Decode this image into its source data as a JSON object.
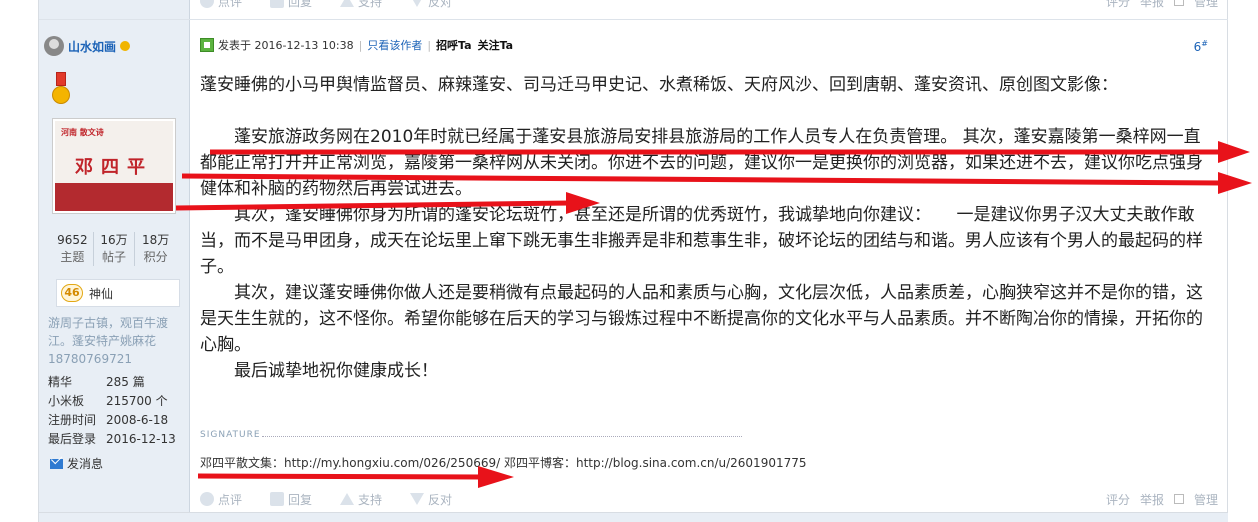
{
  "top_actions": {
    "items": [
      "点评",
      "回复",
      "支持",
      "反对"
    ],
    "right": [
      "评分",
      "举报",
      "管理"
    ]
  },
  "user": {
    "name": "山水如画",
    "avatar_logo": "河南 散文诗",
    "avatar_title": "邓四平",
    "stats": [
      {
        "value": "9652",
        "label": "主题"
      },
      {
        "value": "16万",
        "label": "帖子"
      },
      {
        "value": "18万",
        "label": "积分"
      }
    ],
    "level_num": "46",
    "level_name": "神仙",
    "bio": "游周子古镇，观百牛渡江。蓬安特产姚麻花18780769721",
    "profile": [
      {
        "key": "精华",
        "value": "285 篇"
      },
      {
        "key": "小米板",
        "value": "215700 个"
      },
      {
        "key": "注册时间",
        "value": "2008-6-18"
      },
      {
        "key": "最后登录",
        "value": "2016-12-13"
      }
    ],
    "message_link": "发消息"
  },
  "post": {
    "posted_at": "发表于 2016-12-13 10:38",
    "only_author": "只看该作者",
    "greet": "招呼Ta",
    "follow": "关注Ta",
    "floor": "6",
    "floor_sup": "#",
    "paragraphs": [
      "蓬安睡佛的小马甲舆情监督员、麻辣蓬安、司马迁马甲史记、水煮稀饭、天府风沙、回到唐朝、蓬安资讯、原创图文影像：",
      "",
      "　　蓬安旅游政务网在2010年时就已经属于蓬安县旅游局安排县旅游局的工作人员专人在负责管理。 其次，蓬安嘉陵第一桑梓网一直都能正常打开并正常浏览，嘉陵第一桑梓网从未关闭。你进不去的问题，建议你一是更换你的浏览器，如果还进不去，建议你吃点强身健体和补脑的药物然后再尝试进去。",
      "　　其次，蓬安睡佛你身为所谓的蓬安论坛斑竹，甚至还是所谓的优秀斑竹，我诚挚地向你建议：　　一是建议你男子汉大丈夫敢作敢当，而不是马甲团身，成天在论坛里上窜下跳无事生非搬弄是非和惹事生非，破坏论坛的团结与和谐。男人应该有个男人的最起码的样子。",
      "　　其次，建议蓬安睡佛你做人还是要稍微有点最起码的人品和素质与心胸，文化层次低，人品素质差，心胸狭窄这并不是你的错，这是天生生就的，这不怪你。希望你能够在后天的学习与锻炼过程中不断提高你的文化水平与人品素质。并不断陶冶你的情操，开拓你的心胸。",
      "　　最后诚挚地祝你健康成长！"
    ],
    "signature_label": "SIGNATURE",
    "signature": "邓四平散文集：http://my.hongxiu.com/026/250669/  邓四平博客：http://blog.sina.com.cn/u/2601901775"
  },
  "actions": {
    "items": [
      "点评",
      "回复",
      "支持",
      "反对"
    ],
    "right": [
      "评分",
      "举报",
      "管理"
    ]
  },
  "colors": {
    "arrow": "#e8121a",
    "link": "#1c63b7",
    "sidebar_bg": "#e8eef5"
  }
}
